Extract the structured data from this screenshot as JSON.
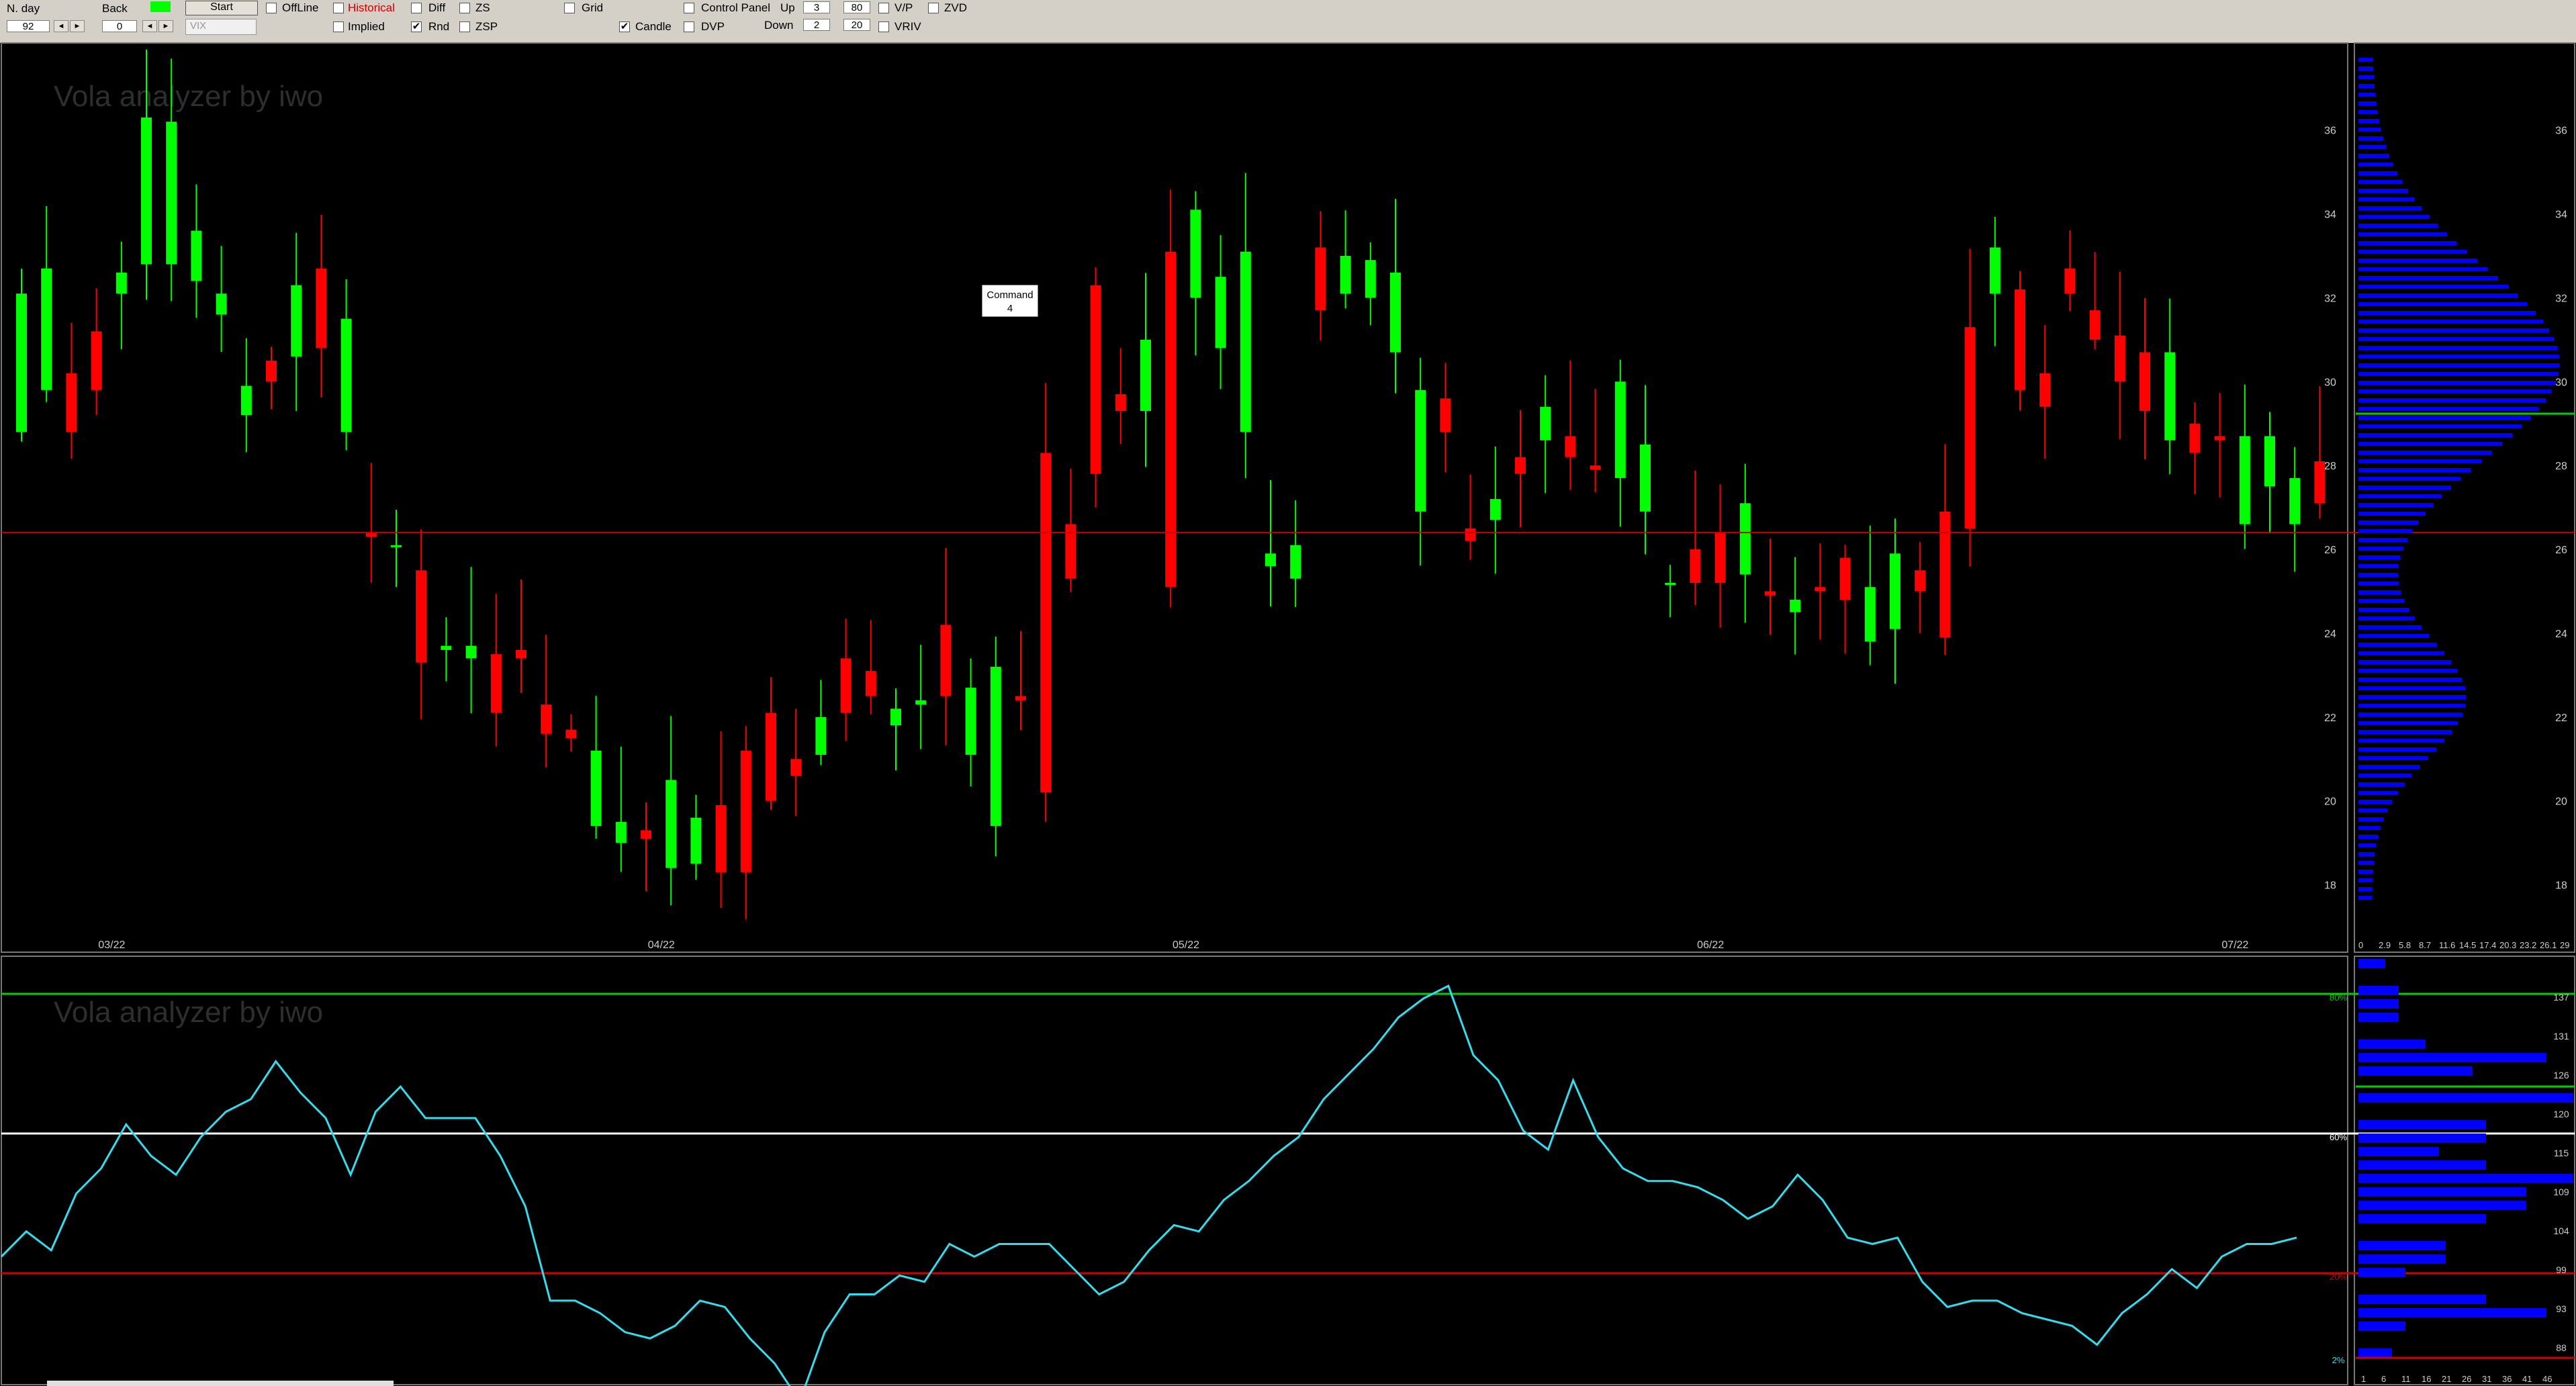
{
  "toolbar": {
    "nday_label": "N. day",
    "nday_value": "92",
    "back_label": "Back",
    "back_value": "0",
    "start_label": "Start",
    "symbol_placeholder": "VIX",
    "offline_label": "OffLine",
    "historical_label": "Historical",
    "implied_label": "Implied",
    "diff_label": "Diff",
    "rnd_label": "Rnd",
    "zs_label": "ZS",
    "zsp_label": "ZSP",
    "grid_label": "Grid",
    "candle_label": "Candle",
    "control_panel_label": "Control Panel",
    "dvp_label": "DVP",
    "up_label": "Up",
    "up_value": "3",
    "up_value2": "80",
    "down_label": "Down",
    "down_value": "2",
    "down_value2": "20",
    "vp_label": "V/P",
    "vriv_label": "VRIV",
    "zvd_label": "ZVD"
  },
  "watermark": "Vola analyzer by iwo",
  "tooltip": {
    "line1": "Command",
    "line2": "4"
  },
  "colors": {
    "up": "#00ff00",
    "down": "#ff0000",
    "profile": "#0000ff",
    "osc": "#33ddee",
    "level": "#cc0000",
    "upper": "#00cc00",
    "mid": "#ffffff"
  },
  "chart_data": [
    {
      "type": "candlestick",
      "yticks": [
        "18",
        "20",
        "22",
        "24",
        "26",
        "28",
        "30",
        "32",
        "34",
        "36"
      ],
      "ylim": [
        17,
        37.5
      ],
      "xticks": [
        {
          "i": 2,
          "label": "03/22"
        },
        {
          "i": 24,
          "label": "04/22"
        },
        {
          "i": 45,
          "label": "05/22"
        },
        {
          "i": 66,
          "label": "06/22"
        },
        {
          "i": 87,
          "label": "07/22"
        }
      ],
      "horizontal_line": 26.4,
      "candles": [
        [
          28.8,
          29.8,
          30.2,
          31.2,
          32.1,
          32.8,
          32.8,
          32.4,
          31.6,
          29.2,
          30.5,
          30.6,
          32.7,
          28.8,
          26.4,
          26.1,
          25.5,
          23.6,
          23.4,
          23.5,
          23.6,
          22.3,
          21.7,
          19.4,
          19.0,
          19.3,
          18.4,
          18.5,
          19.9,
          21.2,
          22.1,
          21.0,
          21.1,
          23.4,
          23.1,
          21.8,
          22.3,
          24.2,
          21.1,
          19.4,
          22.5,
          28.3,
          26.6,
          32.3,
          29.7,
          29.3,
          33.1,
          32.0,
          30.8,
          28.8,
          25.6,
          25.3,
          33.2,
          32.1,
          32.0,
          30.7,
          26.9,
          29.6,
          26.5,
          26.7,
          28.2,
          28.6,
          28.7,
          28.0,
          27.7,
          26.9,
          25.2,
          26.0,
          26.4,
          25.4,
          25.0,
          24.5,
          25.1,
          25.8,
          23.8,
          24.1,
          25.5,
          26.9,
          31.3,
          32.1,
          32.2,
          30.2,
          32.7,
          31.7,
          31.1,
          30.7,
          28.6,
          29.0,
          28.7,
          26.6,
          27.5,
          26.6,
          28.1
        ],
        [
          32.1,
          32.7,
          28.8,
          29.8,
          32.6,
          36.3,
          36.2,
          33.6,
          32.1,
          29.9,
          30.0,
          32.3,
          30.8,
          31.5,
          26.3,
          26.1,
          23.3,
          23.7,
          23.7,
          22.1,
          23.4,
          21.6,
          21.5,
          21.2,
          19.5,
          19.1,
          20.5,
          19.6,
          18.3,
          18.3,
          20.0,
          20.6,
          22.0,
          22.1,
          22.5,
          22.2,
          22.4,
          22.5,
          22.7,
          23.2,
          22.4,
          20.2,
          25.3,
          27.8,
          29.3,
          31.0,
          25.1,
          34.1,
          32.5,
          33.1,
          25.9,
          26.1,
          31.7,
          33.0,
          32.9,
          32.6,
          29.8,
          28.8,
          26.2,
          27.2,
          27.8,
          29.4,
          28.2,
          27.9,
          30.0,
          28.5,
          25.2,
          25.2,
          25.2,
          27.1,
          24.9,
          24.8,
          25.0,
          24.8,
          25.1,
          25.9,
          25.0,
          23.9,
          26.5,
          33.2,
          29.8,
          29.4,
          32.1,
          31.0,
          30.0,
          29.3,
          30.7,
          28.3,
          28.6,
          28.7,
          28.7,
          27.7,
          27.1
        ]
      ]
    },
    {
      "type": "line",
      "values": [
        94,
        98,
        95,
        104,
        108,
        115,
        110,
        107,
        113,
        117,
        119,
        125,
        120,
        116,
        107,
        117,
        121,
        116,
        116,
        116,
        110,
        102,
        87,
        87,
        85,
        82,
        81,
        83,
        87,
        86,
        81,
        77,
        71,
        82,
        88,
        88,
        91,
        90,
        96,
        94,
        96,
        96,
        96,
        92,
        88,
        90,
        95,
        99,
        98,
        103,
        106,
        110,
        113,
        119,
        123,
        127,
        132,
        135,
        137,
        126,
        122,
        114,
        111,
        122,
        113,
        108,
        106,
        106,
        105,
        103,
        100,
        102,
        107,
        103,
        97,
        96,
        97,
        90,
        86,
        87,
        87,
        85,
        84,
        83,
        80,
        85,
        88,
        92,
        89,
        94,
        96,
        96,
        97
      ],
      "ylabels": [
        "80%",
        "60%",
        "20%",
        "2%"
      ]
    },
    {
      "type": "horizontal_bar",
      "xlabels": [
        "0",
        "2.9",
        "5.8",
        "8.7",
        "11.6",
        "14.5",
        "17.4",
        "20.3",
        "23.2",
        "26.1",
        "29"
      ],
      "yticks": [
        "18",
        "20",
        "22",
        "24",
        "26",
        "28",
        "30",
        "32",
        "34",
        "36"
      ]
    },
    {
      "type": "horizontal_bar",
      "xlabels": [
        "1",
        "6",
        "11",
        "16",
        "21",
        "26",
        "31",
        "36",
        "41",
        "46"
      ],
      "yticks": [
        "88",
        "93",
        "99",
        "104",
        "109",
        "115",
        "120",
        "126",
        "131",
        "137"
      ]
    }
  ]
}
